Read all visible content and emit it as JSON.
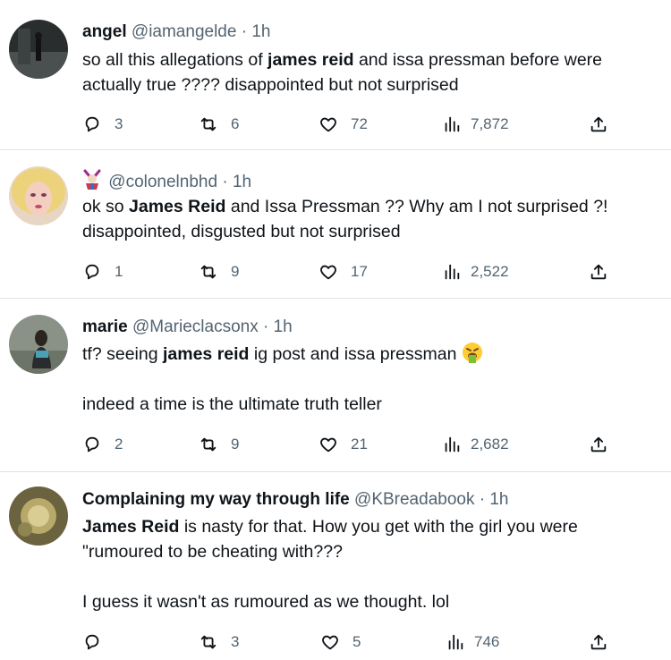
{
  "colors": {
    "text": "#0f1419",
    "muted": "#536471",
    "divider": "#dfe3e6"
  },
  "tweets": [
    {
      "name": "angel",
      "handle": "@iamangelde",
      "sep": "·",
      "time": "1h",
      "body_parts": [
        "so all this allegations of ",
        "james reid",
        " and issa pressman before were actually true ???? disappointed but not surprised"
      ],
      "replies": "3",
      "retweets": "6",
      "likes": "72",
      "views": "7,872"
    },
    {
      "name": "",
      "badge_icon": "jester-emoji",
      "handle": "@colonelnbhd",
      "sep": "·",
      "time": "1h",
      "body_parts": [
        "ok so ",
        "James Reid",
        " and Issa Pressman ?? Why am I not surprised ?!\ndisappointed, disgusted but not surprised"
      ],
      "replies": "1",
      "retweets": "9",
      "likes": "17",
      "views": "2,522"
    },
    {
      "name": "marie",
      "handle": "@Marieclacsonx",
      "sep": "·",
      "time": "1h",
      "body_parts": [
        "tf? seeing ",
        "james reid",
        " ig post and issa pressman "
      ],
      "body_emoji": "vomiting-face-emoji",
      "body_extra": "indeed a time is the ultimate truth teller",
      "replies": "2",
      "retweets": "9",
      "likes": "21",
      "views": "2,682"
    },
    {
      "name": "Complaining my way through life",
      "handle": "@KBreadabook",
      "sep": "·",
      "time": "1h",
      "body_parts": [
        "James Reid",
        " is nasty for that. How you get with the girl you were \"rumoured to be cheating with???\n\nI guess it wasn't as rumoured as we thought. lol"
      ],
      "replies": "",
      "retweets": "3",
      "likes": "5",
      "views": "746"
    }
  ]
}
